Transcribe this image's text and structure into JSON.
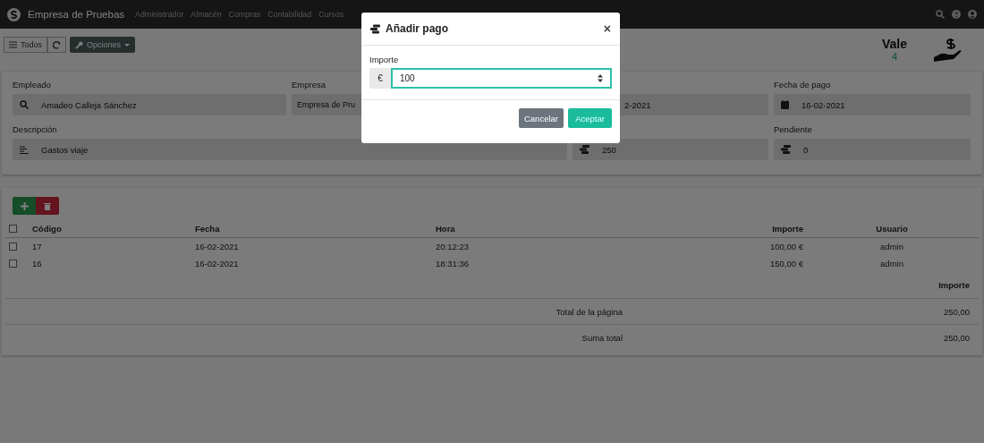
{
  "navbar": {
    "brand": "Empresa de Pruebas",
    "menu": [
      "Administrador",
      "Almacén",
      "Compras",
      "Contabilidad",
      "Cursos"
    ]
  },
  "toolbar": [
    {
      "kind": "list",
      "label": "Todos"
    },
    {
      "kind": "refresh"
    },
    {
      "kind": "dropdown",
      "label": "Opciones"
    }
  ],
  "header": {
    "title": "Vale",
    "count": "4"
  },
  "form": {
    "fields": [
      {
        "kind": "search",
        "wide": false,
        "label": "Empleado",
        "value": "Amadeo Calleja Sánchez"
      },
      {
        "kind": "plain",
        "wide": false,
        "label": "Empresa",
        "value": "Empresa de Pru"
      },
      {
        "kind": "clipped",
        "wide": false,
        "value": "2-2021"
      },
      {
        "kind": "calendar",
        "wide": false,
        "label": "Fecha de pago",
        "value": "16-02-2021"
      },
      {
        "kind": "lines",
        "wide": true,
        "label": "Descripción",
        "value": "Gastos viaje"
      },
      {
        "kind": "coins",
        "wide": false,
        "value": "250"
      },
      {
        "kind": "coins",
        "wide": false,
        "label": "Pendiente",
        "value": "0"
      }
    ]
  },
  "table": {
    "select_all": {
      "checked": false
    },
    "columns": [
      "Código",
      "Fecha",
      "Hora",
      "Importe",
      "Usuario"
    ],
    "rows": [
      {
        "checked": false,
        "cells": [
          "17",
          "16-02-2021",
          "20:12:23",
          "100,00 €",
          "admin"
        ]
      },
      {
        "checked": false,
        "cells": [
          "16",
          "16-02-2021",
          "18:31:36",
          "150,00 €",
          "admin"
        ]
      }
    ]
  },
  "totals": {
    "heading": "Importe",
    "rows": [
      {
        "label": "Total de la página",
        "value": "250,00"
      },
      {
        "label": "Suma total",
        "value": "250,00"
      }
    ]
  },
  "modal": {
    "title": "Añadir pago",
    "close": "×",
    "field_label": "Importe",
    "addon": "€",
    "value": "100",
    "buttons": [
      {
        "kind": "secondary",
        "label": "Cancelar"
      },
      {
        "kind": "primary",
        "label": "Aceptar"
      }
    ]
  }
}
